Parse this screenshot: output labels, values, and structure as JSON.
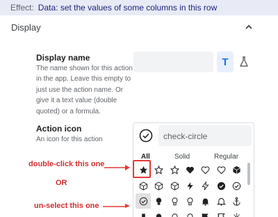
{
  "effect": {
    "label": "Effect:",
    "value": "Data: set the values of some columns in this row"
  },
  "section": {
    "title": "Display",
    "collapse_icon": "chevron-up-icon"
  },
  "display_name": {
    "title": "Display name",
    "help": "The name shown for this action in the app. Leave this empty to just use the action name. Or give it a text value (double quoted) or a formula.",
    "value": "",
    "text_mode_label": "T",
    "formula_icon": "flask-icon"
  },
  "action_icon": {
    "title": "Action icon",
    "help": "An icon for this action",
    "selected_icon": "check-circle-icon",
    "search_value": "check-circle",
    "tabs": [
      "All",
      "Solid",
      "Regular"
    ],
    "active_tab": "All",
    "rows": [
      [
        "star-solid-icon",
        "star-outline-icon",
        "star-outline-icon",
        "heart-solid-icon",
        "heart-outline-icon",
        "heart-outline-icon",
        "cube-solid-icon"
      ],
      [
        "cube-outline-icon",
        "cube-outline-icon",
        "cube-outline-icon",
        "bolt-solid-icon",
        "bolt-outline-icon",
        "check-circle-solid-icon",
        "check-circle-outline-icon"
      ],
      [
        "check-circle-outline-icon",
        "lightbulb-solid-icon",
        "lightbulb-outline-icon",
        "lightbulb-outline-icon",
        "bell-solid-icon",
        "bell-outline-icon",
        "anchor-icon"
      ],
      [
        "cubes-icon",
        "lightbulb-solid-icon",
        "lightbulb-outline-icon",
        "lightbulb-outline-icon",
        "flag-icon",
        "flag-outline-icon",
        "settings-icon"
      ]
    ]
  },
  "annotations": {
    "double_click": "double-click this one",
    "or": "OR",
    "unselect": "un-select this one"
  },
  "colors": {
    "effect_bg": "#e8eaf6",
    "effect_text": "#1a237e",
    "accent": "#1a73e8",
    "annotation": "#d32f2f",
    "highlight_border": "#e53935"
  }
}
